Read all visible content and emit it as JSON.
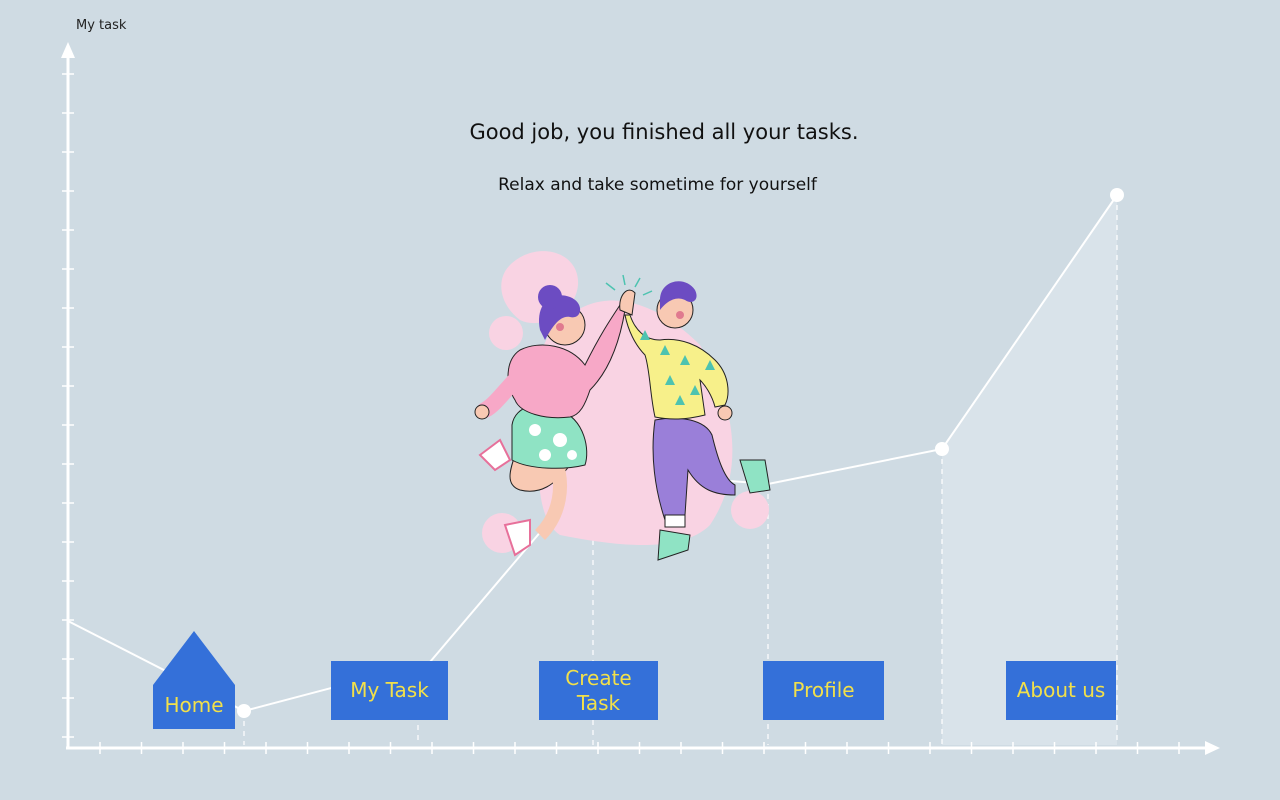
{
  "app": {
    "title": "My task"
  },
  "message": {
    "headline": "Good job, you finished all your tasks.",
    "subline": "Relax and take sometime for yourself"
  },
  "nav": {
    "home": "Home",
    "my_task": "My Task",
    "create_task": "Create Task",
    "profile": "Profile",
    "about_us": "About us"
  },
  "colors": {
    "background": "#cfdbe3",
    "button": "#3470d9",
    "button_text": "#f2e04a",
    "axis": "#ffffff"
  }
}
